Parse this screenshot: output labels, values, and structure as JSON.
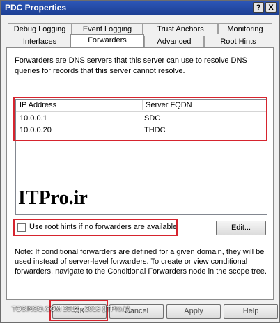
{
  "window": {
    "title": "PDC Properties",
    "help_button": "?",
    "close_button": "X"
  },
  "tabs_row1": [
    "Debug Logging",
    "Event Logging",
    "Trust Anchors",
    "Monitoring"
  ],
  "tabs_row2": [
    "Interfaces",
    "Forwarders",
    "Advanced",
    "Root Hints"
  ],
  "active_tab": "Forwarders",
  "forwarders": {
    "description": "Forwarders are DNS servers that this server can use to resolve DNS queries for records that this server cannot resolve.",
    "columns": [
      "IP Address",
      "Server FQDN"
    ],
    "rows": [
      {
        "ip": "10.0.0.1",
        "fqdn": "SDC"
      },
      {
        "ip": "10.0.0.20",
        "fqdn": "THDC"
      }
    ],
    "watermark": "ITPro.ir",
    "root_hints_label": "Use root hints if no forwarders are available",
    "root_hints_checked": false,
    "edit_button": "Edit...",
    "note": "Note: If conditional forwarders are defined for a given domain, they will be used instead of server-level forwarders.  To create or view conditional forwarders, navigate to the Conditional Forwarders node in the scope tree."
  },
  "buttons": {
    "ok": "OK",
    "cancel": "Cancel",
    "apply": "Apply",
    "help": "Help"
  },
  "footer_watermark": "TOSINSO.COM 2012 - 2013 (ITPro.ir)",
  "colors": {
    "highlight": "#d6242e",
    "titlebar": "#1c3f94"
  }
}
